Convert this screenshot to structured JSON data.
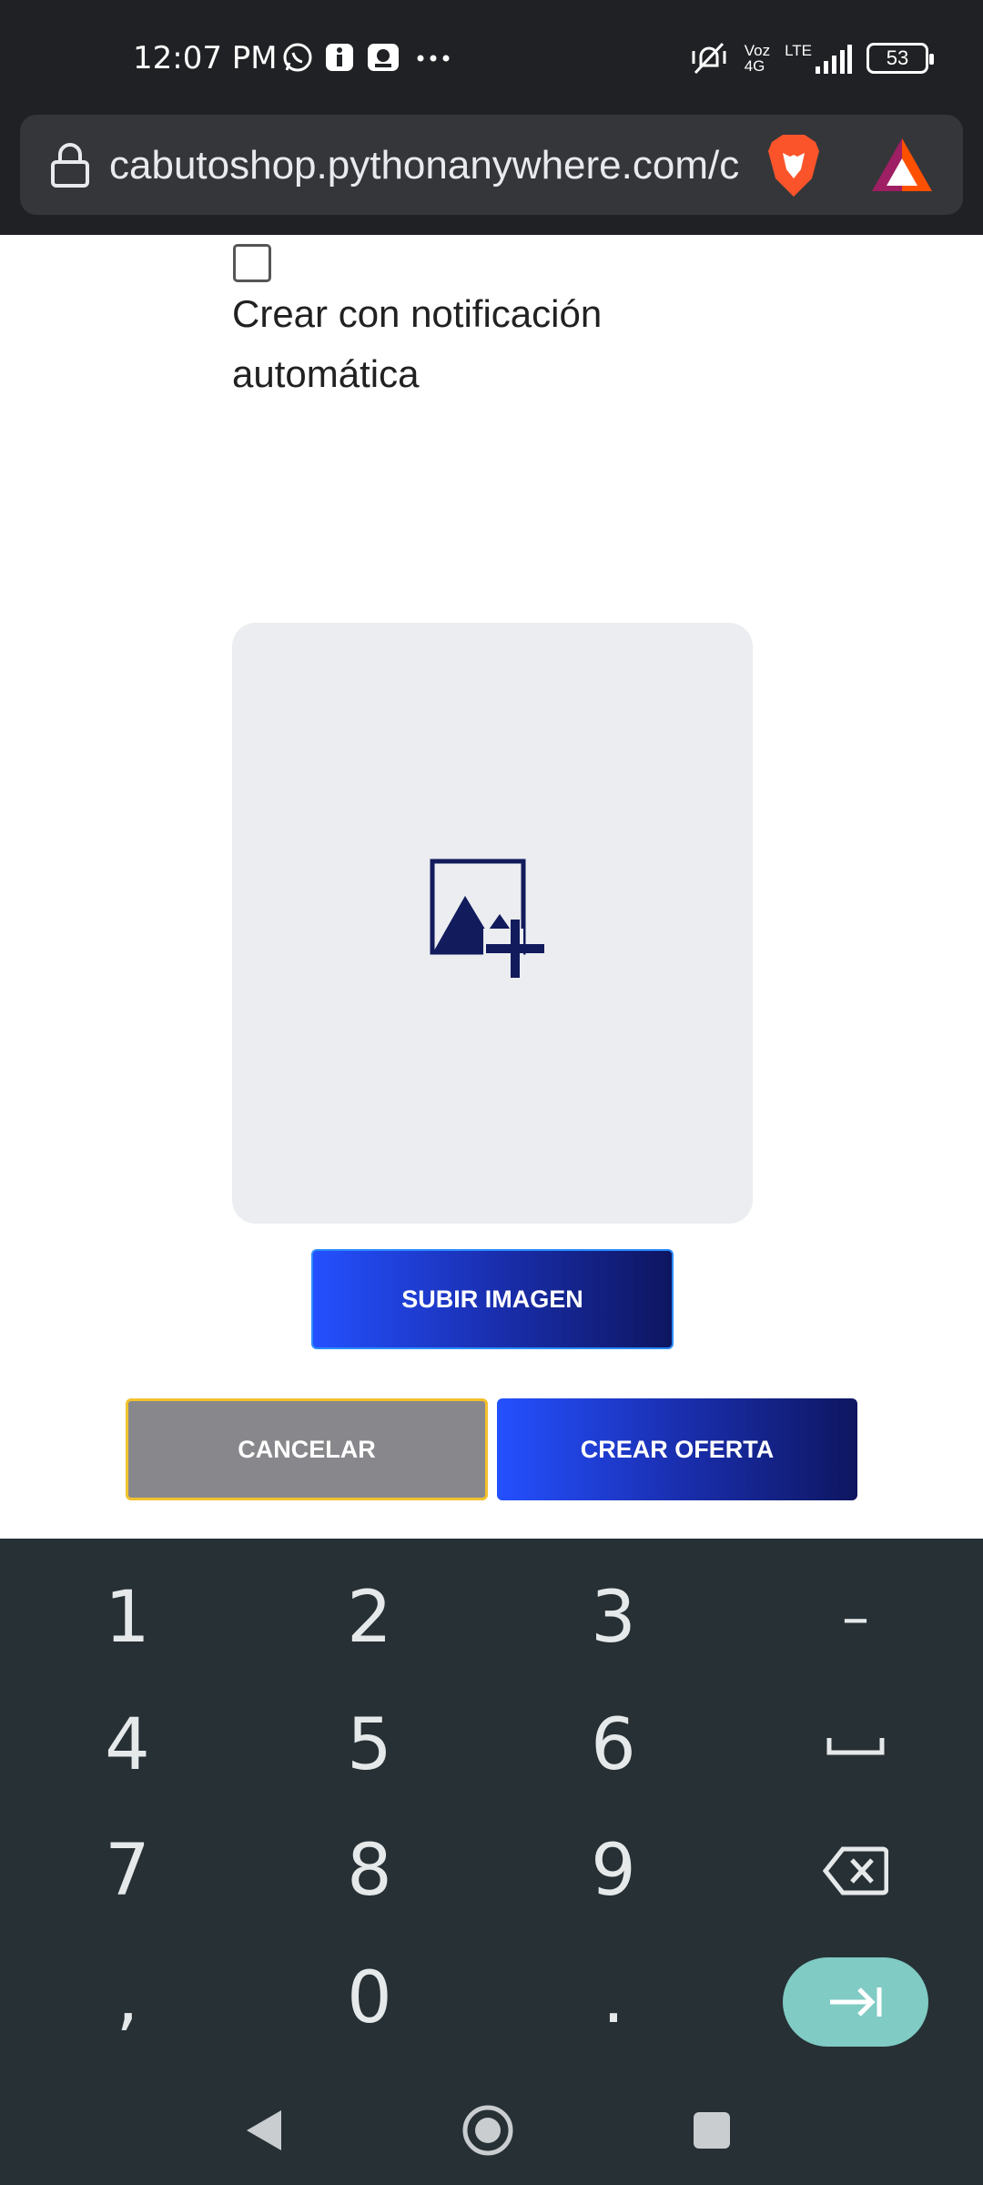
{
  "status_bar": {
    "time": "12:07 PM",
    "left_icons": [
      "whatsapp-icon",
      "info-icon",
      "app-icon",
      "more-icon"
    ],
    "network_voz": "Voz",
    "network_4g": "4G",
    "network_lte": "LTE",
    "battery": "53"
  },
  "browser": {
    "url": "cabutoshop.pythonanywhere.com/c",
    "icons": [
      "lock-icon",
      "brave-icon",
      "bat-icon"
    ]
  },
  "form": {
    "checkbox_checked": false,
    "checkbox_label": "Crear con notificación automática",
    "upload_button": "SUBIR IMAGEN",
    "cancel_button": "CANCELAR",
    "create_button": "CREAR OFERTA"
  },
  "colors": {
    "accent_blue": "#2450ff",
    "dark_blue": "#0e1660",
    "cancel_gray": "#88888c",
    "cancel_border": "#f2c12e",
    "keyboard_bg": "#263035",
    "enter_key": "#80cbc4"
  },
  "keyboard": {
    "rows": [
      [
        "1",
        "2",
        "3",
        "–"
      ],
      [
        "4",
        "5",
        "6",
        "␣"
      ],
      [
        "7",
        "8",
        "9",
        "⌫"
      ],
      [
        ",",
        "0",
        ".",
        "⇥"
      ]
    ]
  },
  "navigation": [
    "back-icon",
    "home-icon",
    "recents-icon"
  ]
}
